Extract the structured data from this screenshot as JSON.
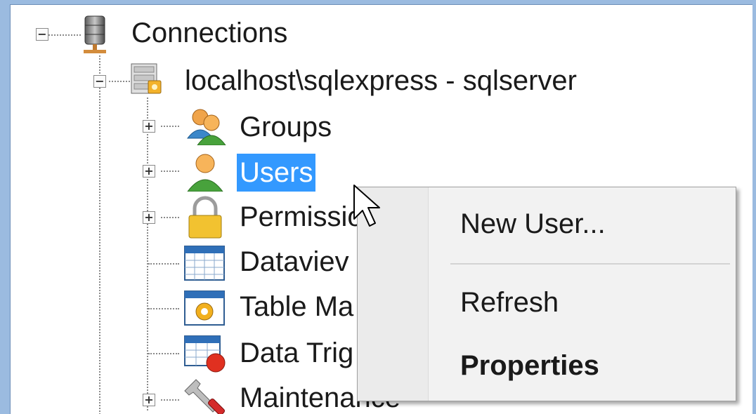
{
  "tree": {
    "root": {
      "label": "Connections",
      "icon": "database-server-icon",
      "expanded": true
    },
    "server": {
      "label": "localhost\\sqlexpress - sqlserver",
      "icon": "server-icon",
      "expanded": true
    },
    "children": [
      {
        "label": "Groups",
        "icon": "groups-icon",
        "expandable": true,
        "selected": false
      },
      {
        "label": "Users",
        "icon": "user-icon",
        "expandable": true,
        "selected": true
      },
      {
        "label": "Permissio",
        "icon": "lock-icon",
        "expandable": true,
        "selected": false
      },
      {
        "label": "Dataviev",
        "icon": "dataview-icon",
        "expandable": false,
        "selected": false
      },
      {
        "label": "Table Ma",
        "icon": "table-manager-icon",
        "expandable": false,
        "selected": false
      },
      {
        "label": "Data Trig",
        "icon": "data-trigger-icon",
        "expandable": false,
        "selected": false
      },
      {
        "label": "Maintenance",
        "icon": "maintenance-icon",
        "expandable": true,
        "selected": false
      }
    ]
  },
  "context_menu": {
    "items": [
      {
        "label": "New User...",
        "bold": false
      },
      {
        "label": "Refresh",
        "bold": false
      },
      {
        "label": "Properties",
        "bold": true
      }
    ]
  },
  "colors": {
    "selection": "#3399ff",
    "window_frame": "#9bbbe0",
    "menu_background": "#f2f2f2"
  }
}
